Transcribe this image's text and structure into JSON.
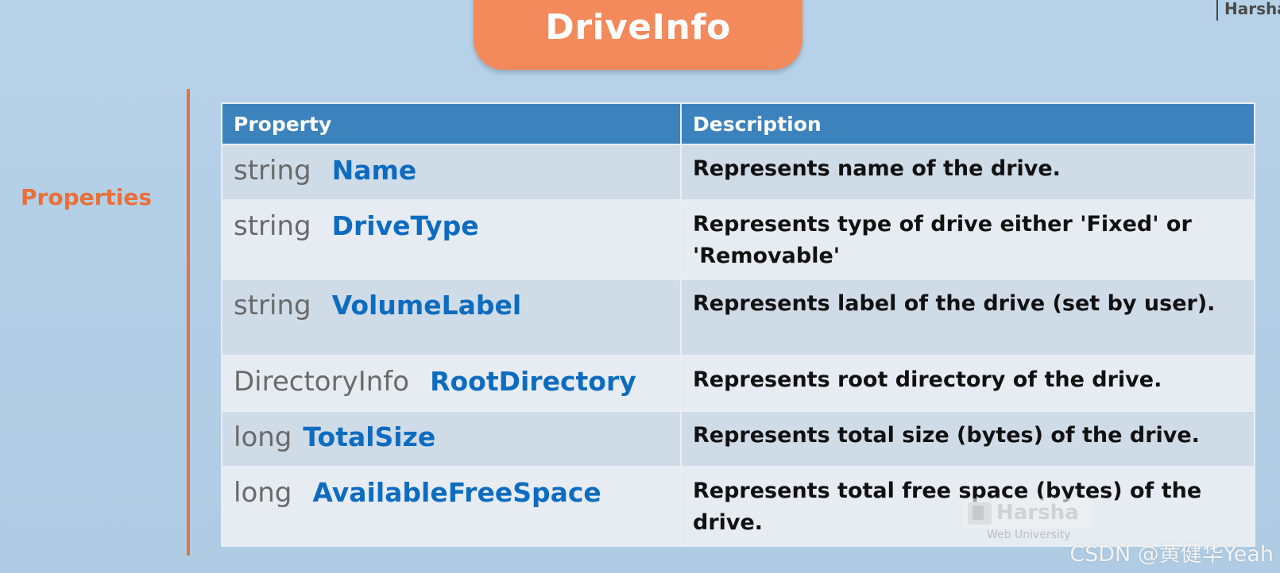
{
  "slide": {
    "title": "DriveInfo",
    "brand_corner": "Harsha",
    "section_label": "Properties"
  },
  "table": {
    "headers": [
      "Property",
      "Description"
    ],
    "rows": [
      {
        "type": "string",
        "name": "Name",
        "description": "Represents name of the drive."
      },
      {
        "type": "string",
        "name": "DriveType",
        "description": "Represents type of drive either 'Fixed' or 'Removable'"
      },
      {
        "type": "string",
        "name": "VolumeLabel",
        "description": "Represents label of the drive (set by user)."
      },
      {
        "type": "DirectoryInfo",
        "name": "RootDirectory",
        "description": "Represents root directory of the drive."
      },
      {
        "type": "long",
        "name": "TotalSize",
        "description": "Represents total size (bytes) of the drive."
      },
      {
        "type": "long",
        "name": "AvailableFreeSpace",
        "description": "Represents total free space (bytes) of the drive."
      }
    ]
  },
  "watermarks": {
    "logo_text": "Harsha",
    "logo_subtext": "Web University",
    "csdn": "CSDN @黄健华Yeah"
  },
  "colors": {
    "accent_orange": "#f28a5c",
    "section_orange": "#e8703a",
    "header_blue": "#3c83bd",
    "property_name_blue": "#0e6cc0",
    "background": "#b3cfe6"
  }
}
